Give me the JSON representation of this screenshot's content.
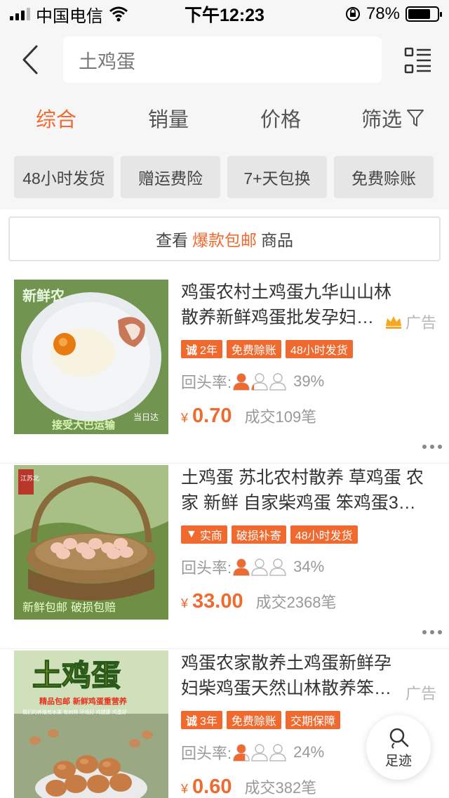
{
  "status_bar": {
    "carrier": "中国电信",
    "time": "下午12:23",
    "battery": "78%",
    "battery_level": 0.78
  },
  "header": {
    "search_value": "土鸡蛋"
  },
  "tabs": [
    {
      "label": "综合",
      "active": true
    },
    {
      "label": "销量",
      "active": false
    },
    {
      "label": "价格",
      "active": false
    },
    {
      "label": "筛选",
      "active": false
    }
  ],
  "chips": [
    "48小时发货",
    "赠运费险",
    "7+天包换",
    "免费赊账"
  ],
  "banner": {
    "prefix": "查看",
    "highlight": "爆款包邮",
    "suffix": "商品"
  },
  "items": [
    {
      "title": "鸡蛋农村土鸡蛋九华山山林散养新鲜鸡蛋批发孕妇…",
      "ad_label": "广告",
      "show_crown": true,
      "tags": [
        {
          "icon": "诚",
          "text": "2年"
        },
        {
          "icon": "",
          "text": "免费赊账"
        },
        {
          "icon": "",
          "text": "48小时发货"
        }
      ],
      "repeat_label": "回头率:",
      "repeat_rate": "39%",
      "repeat_level": 0.39,
      "currency": "¥",
      "price": "0.70",
      "sold": "成交109笔",
      "image_caption": "接受大巴运输",
      "image_badge": "当日达",
      "image_logo": "新鲜农"
    },
    {
      "title": "土鸡蛋 苏北农村散养 草鸡蛋 农家 新鲜 自家柴鸡蛋 笨鸡蛋3…",
      "ad_label": "",
      "show_crown": false,
      "tags": [
        {
          "icon": "▼",
          "text": "实商"
        },
        {
          "icon": "",
          "text": "破损补寄"
        },
        {
          "icon": "",
          "text": "48小时发货"
        }
      ],
      "repeat_label": "回头率:",
      "repeat_rate": "34%",
      "repeat_level": 0.34,
      "currency": "¥",
      "price": "33.00",
      "sold": "成交2368笔",
      "image_caption": "新鲜包邮  破损包赔",
      "image_stamp": "江苏北"
    },
    {
      "title": "鸡蛋农家散养土鸡蛋新鲜孕妇柴鸡蛋天然山林散养笨…",
      "ad_label": "广告",
      "show_crown": false,
      "tags": [
        {
          "icon": "诚",
          "text": "3年"
        },
        {
          "icon": "",
          "text": "免费赊账"
        },
        {
          "icon": "",
          "text": "交期保障"
        }
      ],
      "repeat_label": "回头率:",
      "repeat_rate": "24%",
      "repeat_level": 0.24,
      "currency": "¥",
      "price": "0.60",
      "sold": "成交382笔",
      "image_title": "土鸡蛋",
      "image_subtitle": "精品包邮 新鲜鸡蛋重营养",
      "image_small": "我们的养殖有水果 有树林 环境好 鸡健康 鸡蛋好"
    }
  ],
  "footprint": {
    "label": "足迹"
  },
  "colors": {
    "accent": "#f0692f",
    "gray_bg": "#f6f6f6"
  }
}
